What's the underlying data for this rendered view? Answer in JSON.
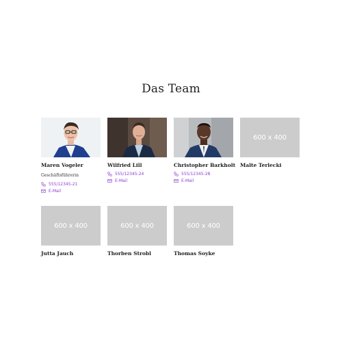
{
  "section": {
    "title": "Das Team"
  },
  "colors": {
    "accent": "#8b3fd1",
    "placeholder_bg": "#cccccc"
  },
  "team": [
    {
      "name": "Maren Vogeler",
      "role": "Geschäftsführerin",
      "phone": "555/12345-21",
      "email": "E-Mail",
      "photo": "woman-portrait"
    },
    {
      "name": "Wilfried Lill",
      "phone": "555/12345-24",
      "email": "E-Mail",
      "photo": "man-portrait-dark-office"
    },
    {
      "name": "Christopher Barkholt",
      "phone": "555/12345-28",
      "email": "E-Mail",
      "photo": "man-portrait-grey-wall"
    },
    {
      "name": "Malte Terlecki",
      "placeholder": "600 x 400"
    },
    {
      "name": "Jutta Jauch",
      "placeholder": "600 x 400"
    },
    {
      "name": "Thorben Strobl",
      "placeholder": "600 x 400"
    },
    {
      "name": "Thomas Soyke",
      "placeholder": "600 x 400"
    }
  ]
}
